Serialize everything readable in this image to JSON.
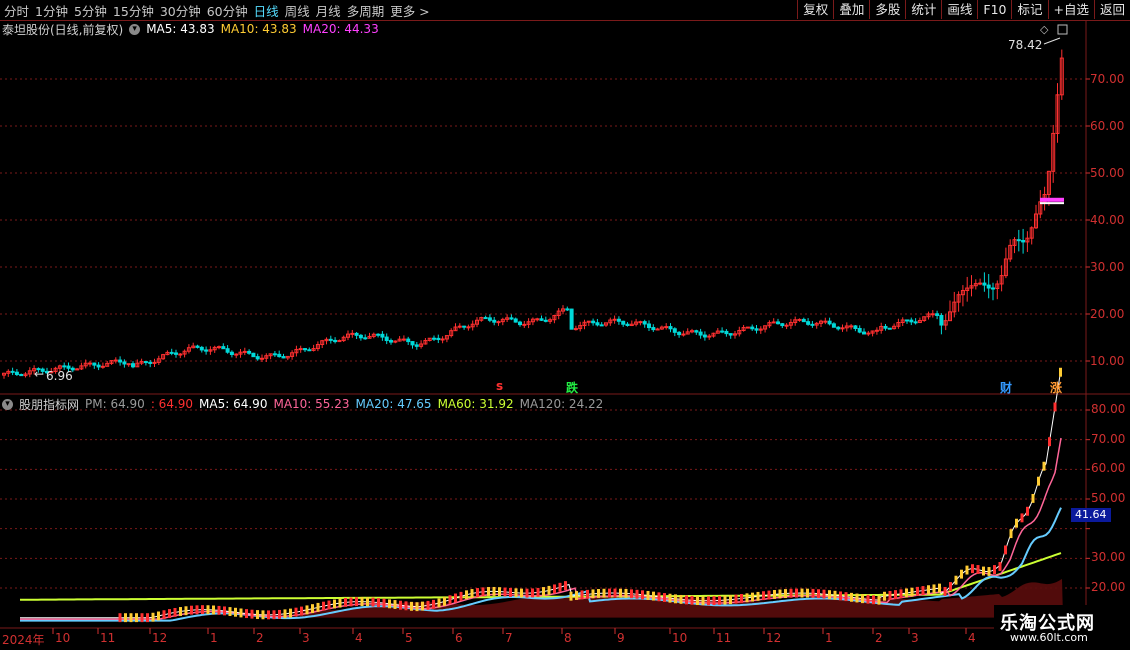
{
  "toolbar": {
    "periods": [
      "分时",
      "1分钟",
      "5分钟",
      "15分钟",
      "30分钟",
      "60分钟",
      "日线",
      "周线",
      "月线",
      "多周期",
      "更多 >"
    ],
    "active_period": "日线",
    "buttons": [
      "复权",
      "叠加",
      "多股",
      "统计",
      "画线",
      "F10",
      "标记",
      "+自选",
      "返回"
    ]
  },
  "main": {
    "title": "泰坦股份(日线,前复权)",
    "ma5_label": "MA5: 43.83",
    "ma10_label": "MA10: 43.83",
    "ma20_label": "MA20: 44.33",
    "high_label": "78.42",
    "low_label": "6.96",
    "y_ticks": [
      "70.00",
      "60.00",
      "50.00",
      "40.00",
      "30.00",
      "20.00",
      "10.00"
    ],
    "markers": {
      "s": "s",
      "die": "跌",
      "cai": "财",
      "zhang": "涨"
    }
  },
  "sub": {
    "title": "股朋指标网",
    "pm_label": "PM: 64.90",
    "pm_value": ": 64.90",
    "ma5_label": "MA5: 64.90",
    "ma10_label": "MA10: 55.23",
    "ma20_label": "MA20: 47.65",
    "ma60_label": "MA60: 31.92",
    "ma120_label": "MA120: 24.22",
    "y_ticks": [
      "80.00",
      "70.00",
      "60.00",
      "50.00",
      "40.00",
      "30.00",
      "20.00"
    ],
    "current_tag": "41.64"
  },
  "x_axis": [
    "2024年",
    "10",
    "11",
    "12",
    "1",
    "2",
    "3",
    "4",
    "5",
    "6",
    "7",
    "8",
    "9",
    "10",
    "11",
    "12",
    "1",
    "2",
    "3",
    "4"
  ],
  "watermark": {
    "title": "乐淘公式网",
    "url": "www.60lt.com"
  },
  "colors": {
    "up": "#ff3030",
    "down": "#00d8d8",
    "ma5": "#ffffff",
    "ma10": "#ffcc33",
    "ma20": "#ff40ff",
    "grid": "#7a1a1a",
    "axis": "#d03030"
  }
}
